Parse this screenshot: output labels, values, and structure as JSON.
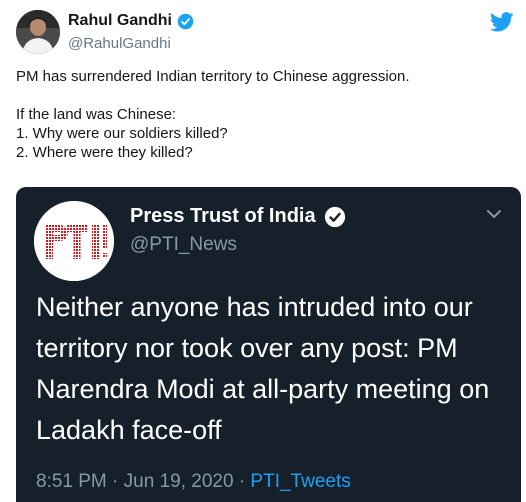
{
  "tweet": {
    "author": {
      "display_name": "Rahul Gandhi",
      "handle": "@RahulGandhi",
      "verified": true
    },
    "text": {
      "line1": "PM has surrendered Indian territory to Chinese aggression.",
      "line2": "If the land was Chinese:",
      "line3": "1. Why were our soldiers killed?",
      "line4": "2. Where were they killed?"
    },
    "logo_icon": "twitter-bird-icon"
  },
  "embedded_tweet": {
    "theme": "dark",
    "author": {
      "display_name": "Press Trust of India",
      "handle": "@PTI_News",
      "avatar_text": "PTI",
      "verified": true
    },
    "text": "Neither anyone has intruded into our territory nor took over any post: PM Narendra Modi at all-party meeting on Ladakh face-off",
    "meta": {
      "time": "8:51 PM",
      "separator": "·",
      "date": "Jun 19, 2020",
      "source": "PTI_Tweets"
    }
  },
  "colors": {
    "twitter_blue": "#1da1f2",
    "dark_background": "#15202b",
    "muted_text": "#657786",
    "pti_red": "#d9161c"
  }
}
